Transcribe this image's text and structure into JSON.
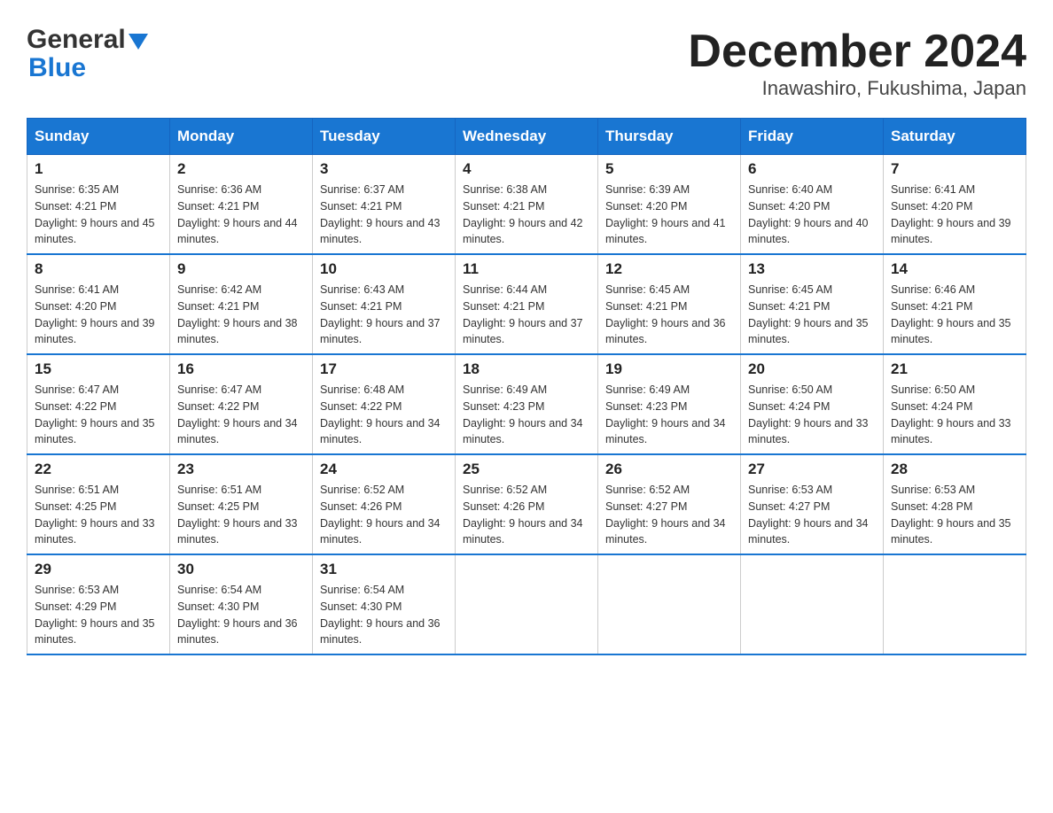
{
  "header": {
    "logo_general": "General",
    "logo_blue": "Blue",
    "month_year": "December 2024",
    "location": "Inawashiro, Fukushima, Japan"
  },
  "days_of_week": [
    "Sunday",
    "Monday",
    "Tuesday",
    "Wednesday",
    "Thursday",
    "Friday",
    "Saturday"
  ],
  "weeks": [
    [
      {
        "day": "1",
        "sunrise": "6:35 AM",
        "sunset": "4:21 PM",
        "daylight": "9 hours and 45 minutes."
      },
      {
        "day": "2",
        "sunrise": "6:36 AM",
        "sunset": "4:21 PM",
        "daylight": "9 hours and 44 minutes."
      },
      {
        "day": "3",
        "sunrise": "6:37 AM",
        "sunset": "4:21 PM",
        "daylight": "9 hours and 43 minutes."
      },
      {
        "day": "4",
        "sunrise": "6:38 AM",
        "sunset": "4:21 PM",
        "daylight": "9 hours and 42 minutes."
      },
      {
        "day": "5",
        "sunrise": "6:39 AM",
        "sunset": "4:20 PM",
        "daylight": "9 hours and 41 minutes."
      },
      {
        "day": "6",
        "sunrise": "6:40 AM",
        "sunset": "4:20 PM",
        "daylight": "9 hours and 40 minutes."
      },
      {
        "day": "7",
        "sunrise": "6:41 AM",
        "sunset": "4:20 PM",
        "daylight": "9 hours and 39 minutes."
      }
    ],
    [
      {
        "day": "8",
        "sunrise": "6:41 AM",
        "sunset": "4:20 PM",
        "daylight": "9 hours and 39 minutes."
      },
      {
        "day": "9",
        "sunrise": "6:42 AM",
        "sunset": "4:21 PM",
        "daylight": "9 hours and 38 minutes."
      },
      {
        "day": "10",
        "sunrise": "6:43 AM",
        "sunset": "4:21 PM",
        "daylight": "9 hours and 37 minutes."
      },
      {
        "day": "11",
        "sunrise": "6:44 AM",
        "sunset": "4:21 PM",
        "daylight": "9 hours and 37 minutes."
      },
      {
        "day": "12",
        "sunrise": "6:45 AM",
        "sunset": "4:21 PM",
        "daylight": "9 hours and 36 minutes."
      },
      {
        "day": "13",
        "sunrise": "6:45 AM",
        "sunset": "4:21 PM",
        "daylight": "9 hours and 35 minutes."
      },
      {
        "day": "14",
        "sunrise": "6:46 AM",
        "sunset": "4:21 PM",
        "daylight": "9 hours and 35 minutes."
      }
    ],
    [
      {
        "day": "15",
        "sunrise": "6:47 AM",
        "sunset": "4:22 PM",
        "daylight": "9 hours and 35 minutes."
      },
      {
        "day": "16",
        "sunrise": "6:47 AM",
        "sunset": "4:22 PM",
        "daylight": "9 hours and 34 minutes."
      },
      {
        "day": "17",
        "sunrise": "6:48 AM",
        "sunset": "4:22 PM",
        "daylight": "9 hours and 34 minutes."
      },
      {
        "day": "18",
        "sunrise": "6:49 AM",
        "sunset": "4:23 PM",
        "daylight": "9 hours and 34 minutes."
      },
      {
        "day": "19",
        "sunrise": "6:49 AM",
        "sunset": "4:23 PM",
        "daylight": "9 hours and 34 minutes."
      },
      {
        "day": "20",
        "sunrise": "6:50 AM",
        "sunset": "4:24 PM",
        "daylight": "9 hours and 33 minutes."
      },
      {
        "day": "21",
        "sunrise": "6:50 AM",
        "sunset": "4:24 PM",
        "daylight": "9 hours and 33 minutes."
      }
    ],
    [
      {
        "day": "22",
        "sunrise": "6:51 AM",
        "sunset": "4:25 PM",
        "daylight": "9 hours and 33 minutes."
      },
      {
        "day": "23",
        "sunrise": "6:51 AM",
        "sunset": "4:25 PM",
        "daylight": "9 hours and 33 minutes."
      },
      {
        "day": "24",
        "sunrise": "6:52 AM",
        "sunset": "4:26 PM",
        "daylight": "9 hours and 34 minutes."
      },
      {
        "day": "25",
        "sunrise": "6:52 AM",
        "sunset": "4:26 PM",
        "daylight": "9 hours and 34 minutes."
      },
      {
        "day": "26",
        "sunrise": "6:52 AM",
        "sunset": "4:27 PM",
        "daylight": "9 hours and 34 minutes."
      },
      {
        "day": "27",
        "sunrise": "6:53 AM",
        "sunset": "4:27 PM",
        "daylight": "9 hours and 34 minutes."
      },
      {
        "day": "28",
        "sunrise": "6:53 AM",
        "sunset": "4:28 PM",
        "daylight": "9 hours and 35 minutes."
      }
    ],
    [
      {
        "day": "29",
        "sunrise": "6:53 AM",
        "sunset": "4:29 PM",
        "daylight": "9 hours and 35 minutes."
      },
      {
        "day": "30",
        "sunrise": "6:54 AM",
        "sunset": "4:30 PM",
        "daylight": "9 hours and 36 minutes."
      },
      {
        "day": "31",
        "sunrise": "6:54 AM",
        "sunset": "4:30 PM",
        "daylight": "9 hours and 36 minutes."
      },
      null,
      null,
      null,
      null
    ]
  ],
  "labels": {
    "sunrise": "Sunrise:",
    "sunset": "Sunset:",
    "daylight": "Daylight:"
  }
}
